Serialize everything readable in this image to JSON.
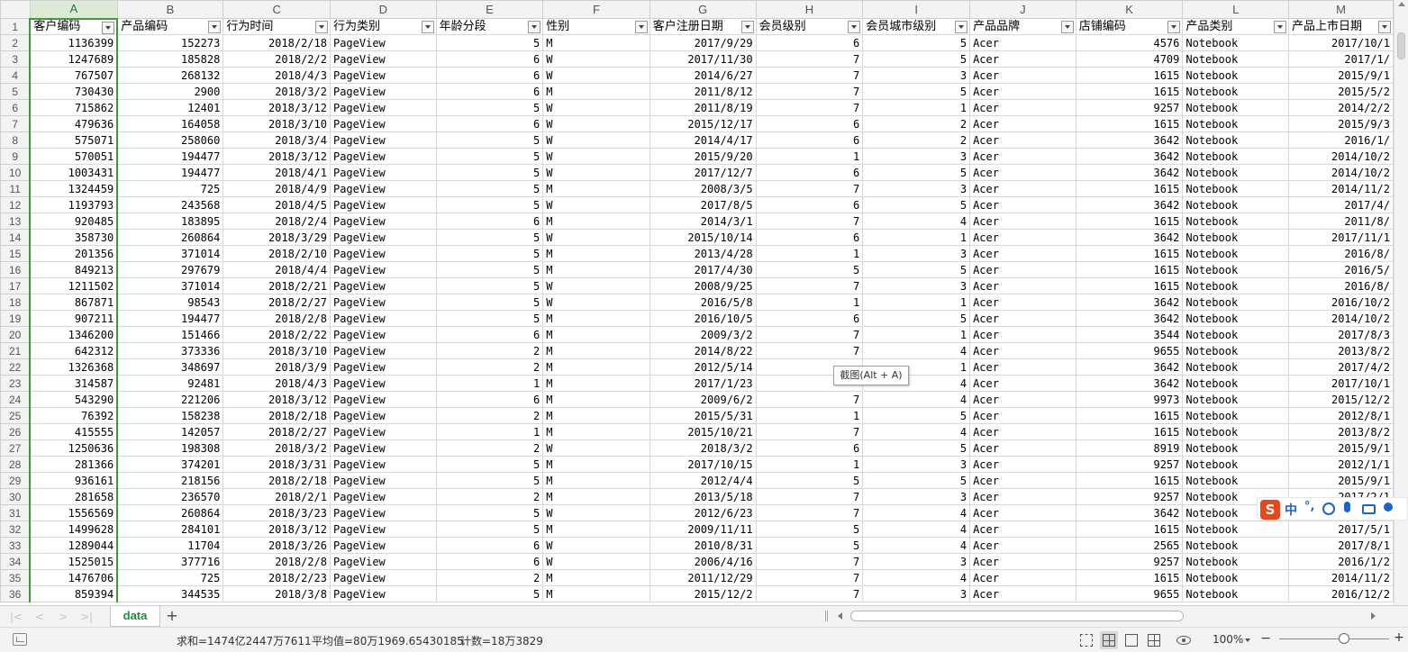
{
  "columns": [
    "A",
    "B",
    "C",
    "D",
    "E",
    "F",
    "G",
    "H",
    "I",
    "J",
    "K",
    "L",
    "M"
  ],
  "headers": [
    "客户编码",
    "产品编码",
    "行为时间",
    "行为类别",
    "年龄分段",
    "性别",
    "客户注册日期",
    "会员级别",
    "会员城市级别",
    "产品品牌",
    "店铺编码",
    "产品类别",
    "产品上市日期"
  ],
  "rows": [
    [
      "1136399",
      "152273",
      "2018/2/18",
      "PageView",
      "5",
      "M",
      "2017/9/29",
      "6",
      "5",
      "Acer",
      "4576",
      "Notebook",
      "2017/10/1"
    ],
    [
      "1247689",
      "185828",
      "2018/2/2",
      "PageView",
      "6",
      "W",
      "2017/11/30",
      "7",
      "5",
      "Acer",
      "4709",
      "Notebook",
      "2017/1/"
    ],
    [
      "767507",
      "268132",
      "2018/4/3",
      "PageView",
      "6",
      "W",
      "2014/6/27",
      "7",
      "3",
      "Acer",
      "1615",
      "Notebook",
      "2015/9/1"
    ],
    [
      "730430",
      "2900",
      "2018/3/2",
      "PageView",
      "6",
      "M",
      "2011/8/12",
      "7",
      "5",
      "Acer",
      "1615",
      "Notebook",
      "2015/5/2"
    ],
    [
      "715862",
      "12401",
      "2018/3/12",
      "PageView",
      "5",
      "W",
      "2011/8/19",
      "7",
      "1",
      "Acer",
      "9257",
      "Notebook",
      "2014/2/2"
    ],
    [
      "479636",
      "164058",
      "2018/3/10",
      "PageView",
      "6",
      "W",
      "2015/12/17",
      "6",
      "2",
      "Acer",
      "1615",
      "Notebook",
      "2015/9/3"
    ],
    [
      "575071",
      "258060",
      "2018/3/4",
      "PageView",
      "5",
      "W",
      "2014/4/17",
      "6",
      "2",
      "Acer",
      "3642",
      "Notebook",
      "2016/1/"
    ],
    [
      "570051",
      "194477",
      "2018/3/12",
      "PageView",
      "5",
      "W",
      "2015/9/20",
      "1",
      "3",
      "Acer",
      "3642",
      "Notebook",
      "2014/10/2"
    ],
    [
      "1003431",
      "194477",
      "2018/4/1",
      "PageView",
      "5",
      "W",
      "2017/12/7",
      "6",
      "5",
      "Acer",
      "3642",
      "Notebook",
      "2014/10/2"
    ],
    [
      "1324459",
      "725",
      "2018/4/9",
      "PageView",
      "5",
      "M",
      "2008/3/5",
      "7",
      "3",
      "Acer",
      "1615",
      "Notebook",
      "2014/11/2"
    ],
    [
      "1193793",
      "243568",
      "2018/4/5",
      "PageView",
      "5",
      "W",
      "2017/8/5",
      "6",
      "5",
      "Acer",
      "3642",
      "Notebook",
      "2017/4/"
    ],
    [
      "920485",
      "183895",
      "2018/2/4",
      "PageView",
      "6",
      "M",
      "2014/3/1",
      "7",
      "4",
      "Acer",
      "1615",
      "Notebook",
      "2011/8/"
    ],
    [
      "358730",
      "260864",
      "2018/3/29",
      "PageView",
      "5",
      "W",
      "2015/10/14",
      "6",
      "1",
      "Acer",
      "3642",
      "Notebook",
      "2017/11/1"
    ],
    [
      "201356",
      "371014",
      "2018/2/10",
      "PageView",
      "5",
      "M",
      "2013/4/28",
      "1",
      "3",
      "Acer",
      "1615",
      "Notebook",
      "2016/8/"
    ],
    [
      "849213",
      "297679",
      "2018/4/4",
      "PageView",
      "5",
      "M",
      "2017/4/30",
      "5",
      "5",
      "Acer",
      "1615",
      "Notebook",
      "2016/5/"
    ],
    [
      "1211502",
      "371014",
      "2018/2/21",
      "PageView",
      "5",
      "W",
      "2008/9/25",
      "7",
      "3",
      "Acer",
      "1615",
      "Notebook",
      "2016/8/"
    ],
    [
      "867871",
      "98543",
      "2018/2/27",
      "PageView",
      "5",
      "W",
      "2016/5/8",
      "1",
      "1",
      "Acer",
      "3642",
      "Notebook",
      "2016/10/2"
    ],
    [
      "907211",
      "194477",
      "2018/2/8",
      "PageView",
      "5",
      "M",
      "2016/10/5",
      "6",
      "5",
      "Acer",
      "3642",
      "Notebook",
      "2014/10/2"
    ],
    [
      "1346200",
      "151466",
      "2018/2/22",
      "PageView",
      "6",
      "M",
      "2009/3/2",
      "7",
      "1",
      "Acer",
      "3544",
      "Notebook",
      "2017/8/3"
    ],
    [
      "642312",
      "373336",
      "2018/3/10",
      "PageView",
      "2",
      "M",
      "2014/8/22",
      "7",
      "4",
      "Acer",
      "9655",
      "Notebook",
      "2013/8/2"
    ],
    [
      "1326368",
      "348697",
      "2018/3/9",
      "PageView",
      "2",
      "M",
      "2012/5/14",
      "",
      "1",
      "Acer",
      "3642",
      "Notebook",
      "2017/4/2"
    ],
    [
      "314587",
      "92481",
      "2018/4/3",
      "PageView",
      "1",
      "M",
      "2017/1/23",
      "",
      "4",
      "Acer",
      "3642",
      "Notebook",
      "2017/10/1"
    ],
    [
      "543290",
      "221206",
      "2018/3/12",
      "PageView",
      "6",
      "M",
      "2009/6/2",
      "7",
      "4",
      "Acer",
      "9973",
      "Notebook",
      "2015/12/2"
    ],
    [
      "76392",
      "158238",
      "2018/2/18",
      "PageView",
      "2",
      "M",
      "2015/5/31",
      "1",
      "5",
      "Acer",
      "1615",
      "Notebook",
      "2012/8/1"
    ],
    [
      "415555",
      "142057",
      "2018/2/27",
      "PageView",
      "1",
      "M",
      "2015/10/21",
      "7",
      "4",
      "Acer",
      "1615",
      "Notebook",
      "2013/8/2"
    ],
    [
      "1250636",
      "198308",
      "2018/3/2",
      "PageView",
      "2",
      "W",
      "2018/3/2",
      "6",
      "5",
      "Acer",
      "8919",
      "Notebook",
      "2015/9/1"
    ],
    [
      "281366",
      "374201",
      "2018/3/31",
      "PageView",
      "5",
      "M",
      "2017/10/15",
      "1",
      "3",
      "Acer",
      "9257",
      "Notebook",
      "2012/1/1"
    ],
    [
      "936161",
      "218156",
      "2018/2/18",
      "PageView",
      "5",
      "M",
      "2012/4/4",
      "5",
      "5",
      "Acer",
      "1615",
      "Notebook",
      "2015/9/1"
    ],
    [
      "281658",
      "236570",
      "2018/2/1",
      "PageView",
      "2",
      "M",
      "2013/5/18",
      "7",
      "3",
      "Acer",
      "9257",
      "Notebook",
      "2017/2/1"
    ],
    [
      "1556569",
      "260864",
      "2018/3/23",
      "PageView",
      "5",
      "W",
      "2012/6/23",
      "7",
      "4",
      "Acer",
      "3642",
      "Notebook",
      ""
    ],
    [
      "1499628",
      "284101",
      "2018/3/12",
      "PageView",
      "5",
      "M",
      "2009/11/11",
      "5",
      "4",
      "Acer",
      "1615",
      "Notebook",
      "2017/5/1"
    ],
    [
      "1289044",
      "11704",
      "2018/3/26",
      "PageView",
      "6",
      "W",
      "2010/8/31",
      "5",
      "4",
      "Acer",
      "2565",
      "Notebook",
      "2017/8/1"
    ],
    [
      "1525015",
      "377716",
      "2018/2/8",
      "PageView",
      "6",
      "W",
      "2006/4/16",
      "7",
      "3",
      "Acer",
      "9257",
      "Notebook",
      "2016/1/2"
    ],
    [
      "1476706",
      "725",
      "2018/2/23",
      "PageView",
      "2",
      "M",
      "2011/12/29",
      "7",
      "4",
      "Acer",
      "1615",
      "Notebook",
      "2014/11/2"
    ],
    [
      "859394",
      "344535",
      "2018/3/8",
      "PageView",
      "5",
      "M",
      "2015/12/2",
      "7",
      "3",
      "Acer",
      "9655",
      "Notebook",
      "2016/12/2"
    ]
  ],
  "tooltip": "截图(Alt + A)",
  "sheet_tab": "data",
  "add_sheet": "+",
  "status": {
    "sum": "求和=1474亿2447万7611",
    "average": "平均值=80万1969.65430185",
    "count": "计数=18万3829"
  },
  "zoom": {
    "label": "100%",
    "minus": "−",
    "plus": "+"
  },
  "ime": {
    "logo": "S",
    "lang": "中",
    "punct": "°,"
  },
  "nav_arrows": [
    "|<",
    "<",
    ">",
    ">|"
  ],
  "icons": {
    "filter": "filter-dropdown-icon",
    "view_normal": "normal-view-icon",
    "view_page": "page-layout-icon",
    "view_break": "page-break-icon",
    "eye": "eye-protection-icon"
  },
  "colors": {
    "accent": "#217346",
    "selection_border": "#3c9a3c",
    "sheet_tab_text": "#1e8a3e",
    "ime_logo": "#e8471c",
    "ime_icons": "#1e63c6"
  }
}
